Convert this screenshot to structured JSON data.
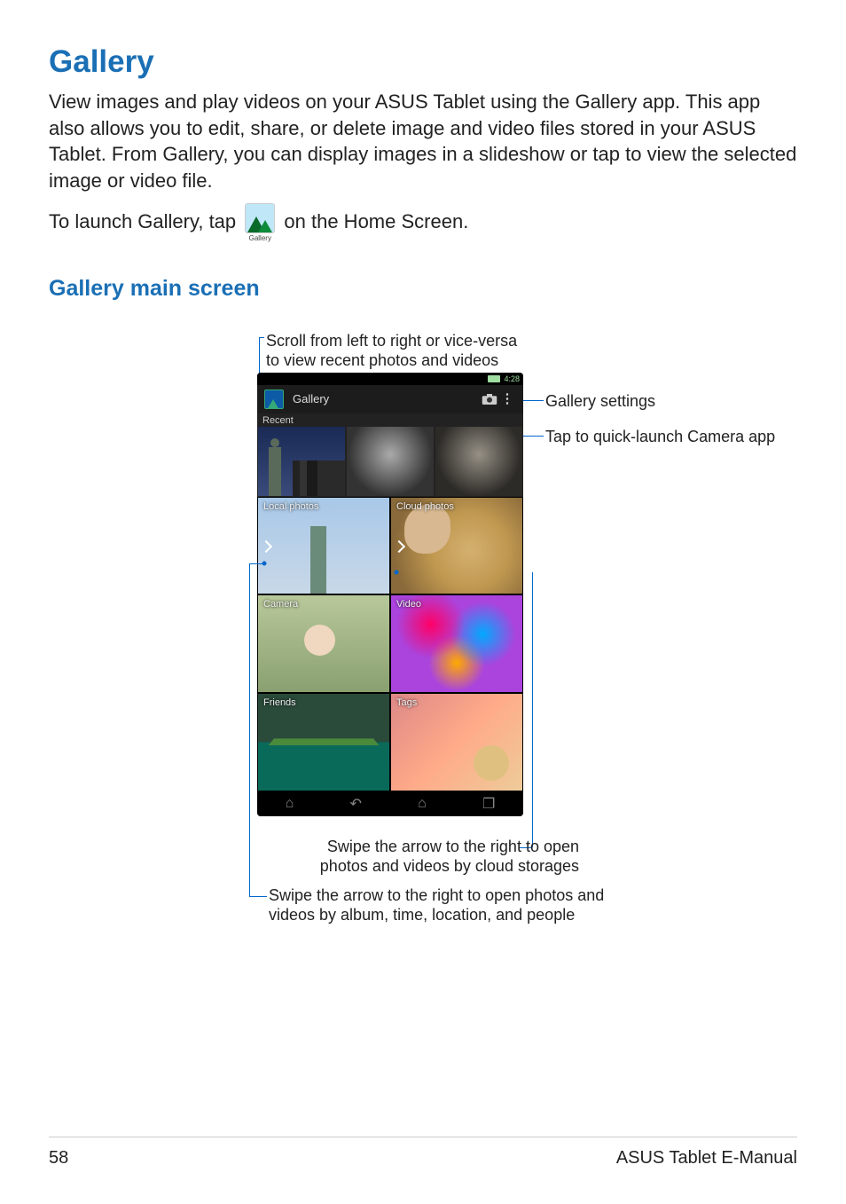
{
  "headings": {
    "h1": "Gallery",
    "h2": "Gallery main screen"
  },
  "paragraphs": {
    "p1": "View images and play videos on your ASUS Tablet using the Gallery app. This app also allows you to edit, share, or delete image and video files stored in your ASUS Tablet. From Gallery, you can display images in a slideshow or tap to view the selected image or video file.",
    "p2_before": "To launch Gallery, tap",
    "p2_after": "on the Home Screen.",
    "icon_label": "Gallery"
  },
  "screenshot": {
    "status_time": "4:28",
    "app_title": "Gallery",
    "sections": {
      "recent": "Recent",
      "local": "Local photos",
      "cloud": "Cloud photos",
      "camera": "Camera",
      "video": "Video",
      "friends": "Friends",
      "tags": "Tags"
    }
  },
  "callouts": {
    "scroll": "Scroll from left to right or vice-versa to view recent photos and videos",
    "settings": "Gallery settings",
    "camera_quick": "Tap to quick-launch Camera app",
    "swipe_cloud": "Swipe the arrow to the right to open photos and videos by cloud storages",
    "swipe_local": "Swipe the arrow to the right to open photos and videos by album, time, location, and people"
  },
  "footer": {
    "page_number": "58",
    "doc_title": "ASUS Tablet E-Manual"
  }
}
